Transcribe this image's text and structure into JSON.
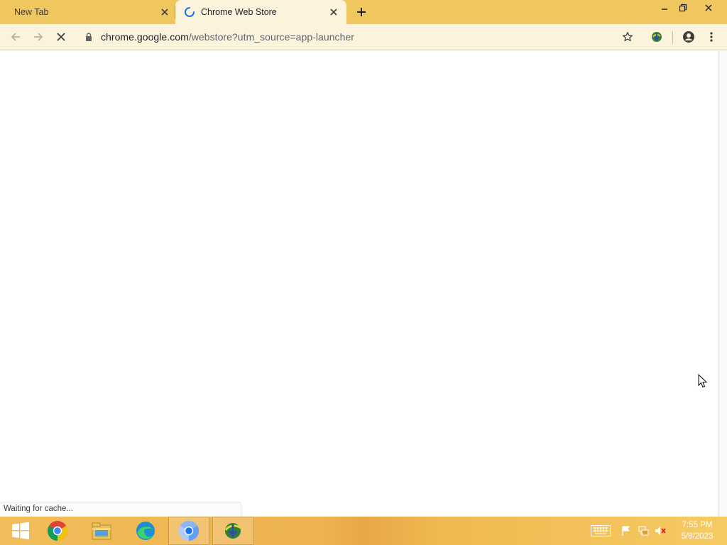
{
  "tabs": [
    {
      "title": "New Tab",
      "active": false
    },
    {
      "title": "Chrome Web Store",
      "active": true,
      "loading": true
    }
  ],
  "toolbar": {
    "url_host": "chrome.google.com",
    "url_path": "/webstore?utm_source=app-launcher"
  },
  "status_bar": {
    "text": "Waiting for cache..."
  },
  "taskbar": {
    "pinned": [
      "windows-start-icon",
      "chrome-icon",
      "file-explorer-icon",
      "edge-icon",
      "chromium-icon",
      "internet-download-manager-icon"
    ],
    "clock_time": "7:55 PM",
    "clock_date": "5/8/2023"
  },
  "colors": {
    "tabstrip": "#f0c75e",
    "toolbar": "#fcf3dd",
    "taskbar": "#f0b850"
  }
}
